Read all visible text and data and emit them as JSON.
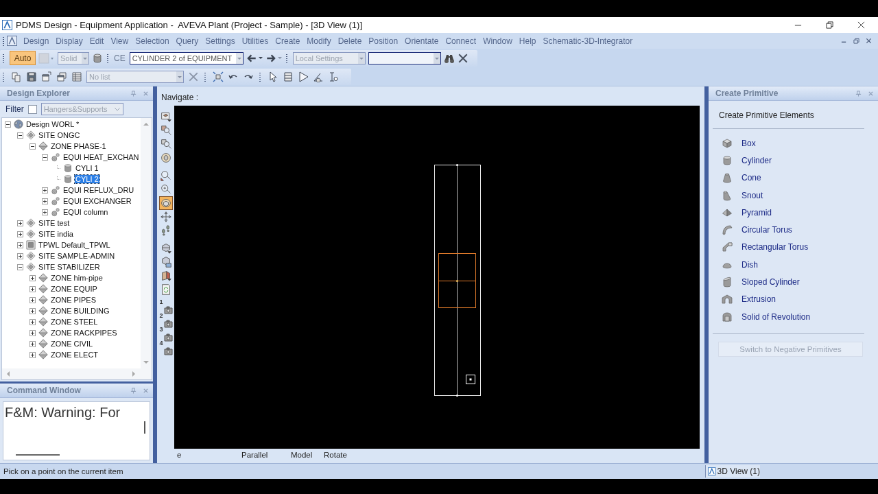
{
  "window": {
    "title": "PDMS Design - Equipment Application -  AVEVA Plant (Project - Sample) - [3D View (1)]"
  },
  "menu": [
    "Design",
    "Display",
    "Edit",
    "View",
    "Selection",
    "Query",
    "Settings",
    "Utilities",
    "Create",
    "Modify",
    "Delete",
    "Position",
    "Orientate",
    "Connect",
    "Window",
    "Help",
    "Schematic-3D-Integrator"
  ],
  "toolbar_1": {
    "mode_button": {
      "label": "Auto",
      "on": true
    },
    "style_combo": {
      "value": "Solid",
      "disabled": true
    },
    "ce_label": "CE",
    "ce_combo": {
      "value": "CYLINDER 2 of EQUIPMENT",
      "disabled": false
    },
    "settings_combo": {
      "value": "Local Settings",
      "disabled": true
    }
  },
  "toolbar_2": {
    "list_combo": {
      "value": "No list",
      "disabled": true
    }
  },
  "design_explorer": {
    "title": "Design Explorer",
    "filter_label": "Filter",
    "filter_checked": false,
    "filter_combo": "Hangers&Supports",
    "tree": [
      {
        "label": "Design WORL *",
        "kind": "world",
        "expanded": true,
        "selected": false,
        "children": [
          {
            "label": "SITE ONGC",
            "kind": "site",
            "expanded": true,
            "selected": false,
            "children": [
              {
                "label": "ZONE PHASE-1",
                "kind": "zone",
                "expanded": true,
                "selected": false,
                "children": [
                  {
                    "label": "EQUI HEAT_EXCHAN",
                    "kind": "equi",
                    "expanded": true,
                    "selected": false,
                    "children": [
                      {
                        "label": "CYLI 1",
                        "kind": "cyli",
                        "selected": false
                      },
                      {
                        "label": "CYLI 2",
                        "kind": "cyli",
                        "selected": true
                      }
                    ]
                  },
                  {
                    "label": "EQUI REFLUX_DRU",
                    "kind": "equi",
                    "expanded": false,
                    "selected": false
                  },
                  {
                    "label": "EQUI EXCHANGER",
                    "kind": "equi",
                    "expanded": false,
                    "selected": false
                  },
                  {
                    "label": "EQUI column",
                    "kind": "equi",
                    "expanded": false,
                    "selected": false
                  }
                ]
              }
            ]
          },
          {
            "label": "SITE test",
            "kind": "site",
            "expanded": false,
            "selected": false
          },
          {
            "label": "SITE india",
            "kind": "site",
            "expanded": false,
            "selected": false
          },
          {
            "label": "TPWL Default_TPWL",
            "kind": "tpwl",
            "expanded": false,
            "selected": false
          },
          {
            "label": "SITE SAMPLE-ADMIN",
            "kind": "site",
            "expanded": false,
            "selected": false
          },
          {
            "label": "SITE STABILIZER",
            "kind": "site",
            "expanded": true,
            "selected": false,
            "children": [
              {
                "label": "ZONE him-pipe",
                "kind": "zone",
                "expanded": false,
                "selected": false
              },
              {
                "label": "ZONE EQUIP",
                "kind": "zone",
                "expanded": false,
                "selected": false
              },
              {
                "label": "ZONE PIPES",
                "kind": "zone",
                "expanded": false,
                "selected": false
              },
              {
                "label": "ZONE BUILDING",
                "kind": "zone",
                "expanded": false,
                "selected": false
              },
              {
                "label": "ZONE STEEL",
                "kind": "zone",
                "expanded": false,
                "selected": false
              },
              {
                "label": "ZONE RACKPIPES",
                "kind": "zone",
                "expanded": false,
                "selected": false
              },
              {
                "label": "ZONE CIVIL",
                "kind": "zone",
                "expanded": false,
                "selected": false
              },
              {
                "label": "ZONE ELECT",
                "kind": "zone",
                "expanded": false,
                "selected": false
              }
            ]
          }
        ]
      }
    ]
  },
  "command_window": {
    "title": "Command Window",
    "text": "F&M: Warning: For"
  },
  "view": {
    "label": "Navigate :",
    "nav_groups": [
      {
        "tools": [
          {
            "kind": "window-select",
            "selected": false
          },
          {
            "kind": "zoom-object",
            "selected": false
          },
          {
            "kind": "zoom-out",
            "selected": false
          },
          {
            "kind": "walk-sphere",
            "selected": false
          }
        ]
      },
      {
        "tools": [
          {
            "kind": "zoom-area",
            "selected": false
          },
          {
            "kind": "zoom-in",
            "selected": false
          },
          {
            "kind": "orbit",
            "selected": true
          },
          {
            "kind": "pan",
            "selected": false
          },
          {
            "kind": "walk",
            "selected": false
          }
        ]
      },
      {
        "tools": [
          {
            "kind": "view-menu",
            "selected": false
          },
          {
            "kind": "view-limits",
            "selected": false
          },
          {
            "kind": "clip",
            "selected": false
          },
          {
            "kind": "refresh",
            "selected": false
          }
        ]
      },
      {
        "tools": [
          {
            "kind": "camera",
            "label": "1",
            "selected": false
          },
          {
            "kind": "camera",
            "label": "2",
            "selected": false
          },
          {
            "kind": "camera",
            "label": "3",
            "selected": false
          },
          {
            "kind": "camera",
            "label": "4",
            "selected": false
          }
        ]
      }
    ],
    "status": [
      "e",
      "Parallel",
      "Model",
      "Rotate"
    ]
  },
  "create_primitive": {
    "title": "Create Primitive",
    "heading": "Create Primitive Elements",
    "items": [
      {
        "label": "Box",
        "kind": "box"
      },
      {
        "label": "Cylinder",
        "kind": "cylinder"
      },
      {
        "label": "Cone",
        "kind": "cone"
      },
      {
        "label": "Snout",
        "kind": "snout"
      },
      {
        "label": "Pyramid",
        "kind": "pyramid"
      },
      {
        "label": "Circular Torus",
        "kind": "circular-torus"
      },
      {
        "label": "Rectangular Torus",
        "kind": "rectangular-torus"
      },
      {
        "label": "Dish",
        "kind": "dish"
      },
      {
        "label": "Sloped Cylinder",
        "kind": "sloped-cylinder"
      },
      {
        "label": "Extrusion",
        "kind": "extrusion"
      },
      {
        "label": "Solid of Revolution",
        "kind": "revolution"
      }
    ],
    "button": {
      "label": "Switch to Negative Primitives",
      "disabled": true
    }
  },
  "status_bar": {
    "prompt": "Pick on a point on the current item",
    "tab": "3D View (1)"
  }
}
